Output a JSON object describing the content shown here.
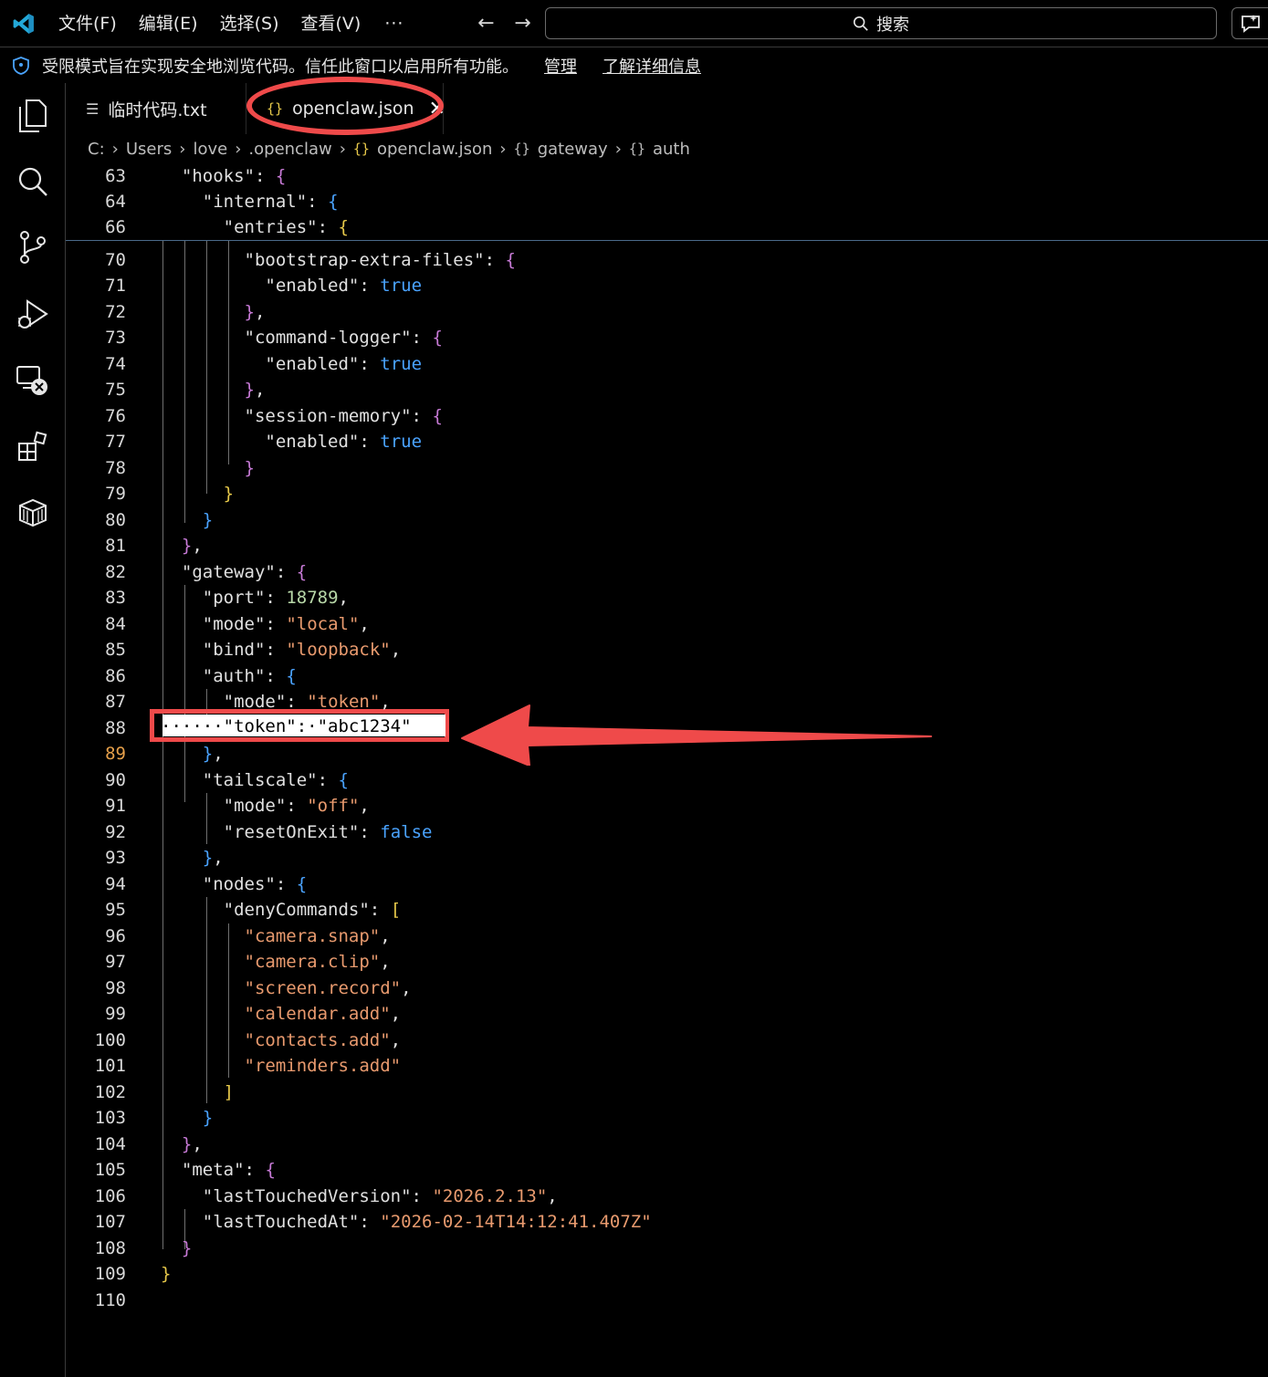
{
  "menu": {
    "file": "文件(F)",
    "edit": "编辑(E)",
    "select": "选择(S)",
    "view": "查看(V)",
    "more": "···"
  },
  "search": {
    "label": "搜索"
  },
  "banner": {
    "message": "受限模式旨在实现安全地浏览代码。信任此窗口以启用所有功能。",
    "manage": "管理",
    "learn_more": "了解详细信息"
  },
  "tabs": [
    {
      "label": "临时代码.txt"
    },
    {
      "label": "openclaw.json"
    }
  ],
  "breadcrumb": {
    "parts": [
      "C:",
      "Users",
      "love",
      ".openclaw",
      "openclaw.json",
      "gateway",
      "auth"
    ]
  },
  "editor": {
    "current_line": "89",
    "highlighted_token_line": "······\"token\":·\"abc1234\"",
    "lines": [
      {
        "n": "63",
        "code": "  \"hooks\": {"
      },
      {
        "n": "64",
        "code": "    \"internal\": {"
      },
      {
        "n": "66",
        "code": "      \"entries\": {"
      },
      {
        "n": "70",
        "code": "        \"bootstrap-extra-files\": {"
      },
      {
        "n": "71",
        "code": "          \"enabled\": true"
      },
      {
        "n": "72",
        "code": "        },"
      },
      {
        "n": "73",
        "code": "        \"command-logger\": {"
      },
      {
        "n": "74",
        "code": "          \"enabled\": true"
      },
      {
        "n": "75",
        "code": "        },"
      },
      {
        "n": "76",
        "code": "        \"session-memory\": {"
      },
      {
        "n": "77",
        "code": "          \"enabled\": true"
      },
      {
        "n": "78",
        "code": "        }"
      },
      {
        "n": "79",
        "code": "      }"
      },
      {
        "n": "80",
        "code": "    }"
      },
      {
        "n": "81",
        "code": "  },"
      },
      {
        "n": "82",
        "code": "  \"gateway\": {"
      },
      {
        "n": "83",
        "code": "    \"port\": 18789,"
      },
      {
        "n": "84",
        "code": "    \"mode\": \"local\","
      },
      {
        "n": "85",
        "code": "    \"bind\": \"loopback\","
      },
      {
        "n": "86",
        "code": "    \"auth\": {"
      },
      {
        "n": "87",
        "code": "      \"mode\": \"token\","
      },
      {
        "n": "88",
        "code": ""
      },
      {
        "n": "89",
        "code": "    },"
      },
      {
        "n": "90",
        "code": "    \"tailscale\": {"
      },
      {
        "n": "91",
        "code": "      \"mode\": \"off\","
      },
      {
        "n": "92",
        "code": "      \"resetOnExit\": false"
      },
      {
        "n": "93",
        "code": "    },"
      },
      {
        "n": "94",
        "code": "    \"nodes\": {"
      },
      {
        "n": "95",
        "code": "      \"denyCommands\": ["
      },
      {
        "n": "96",
        "code": "        \"camera.snap\","
      },
      {
        "n": "97",
        "code": "        \"camera.clip\","
      },
      {
        "n": "98",
        "code": "        \"screen.record\","
      },
      {
        "n": "99",
        "code": "        \"calendar.add\","
      },
      {
        "n": "100",
        "code": "        \"contacts.add\","
      },
      {
        "n": "101",
        "code": "        \"reminders.add\""
      },
      {
        "n": "102",
        "code": "      ]"
      },
      {
        "n": "103",
        "code": "    }"
      },
      {
        "n": "104",
        "code": "  },"
      },
      {
        "n": "105",
        "code": "  \"meta\": {"
      },
      {
        "n": "106",
        "code": "    \"lastTouchedVersion\": \"2026.2.13\","
      },
      {
        "n": "107",
        "code": "    \"lastTouchedAt\": \"2026-02-14T14:12:41.407Z\""
      },
      {
        "n": "108",
        "code": "  }"
      },
      {
        "n": "109",
        "code": "}"
      },
      {
        "n": "110",
        "code": ""
      }
    ]
  },
  "colors": {
    "accent_annotation": "#ef4a4a",
    "string": "#e89a6e",
    "number": "#b8d8a8",
    "boolean": "#4aa3ff"
  }
}
